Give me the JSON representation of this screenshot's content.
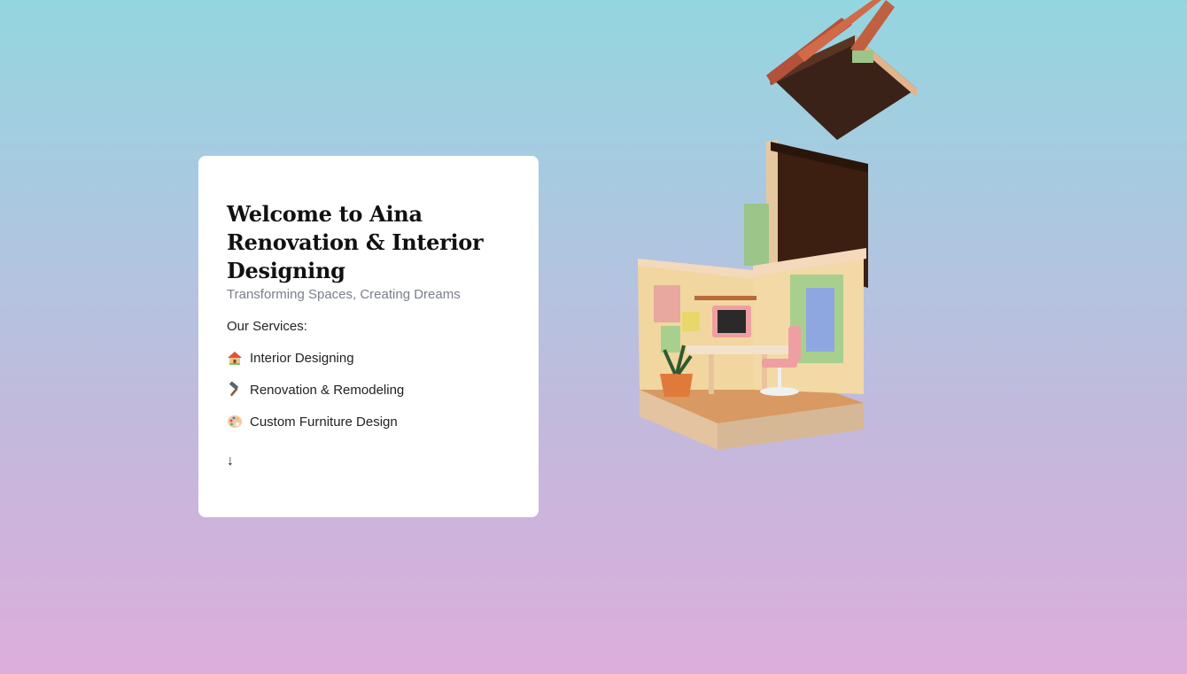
{
  "hero": {
    "title_line1": "Welcome to Aina",
    "title_line2": "Renovation & Interior",
    "title_line3": "Designing",
    "subtitle": "Transforming Spaces, Creating Dreams"
  },
  "services": {
    "heading": "Our Services:",
    "items": [
      {
        "icon": "house-icon",
        "label": "Interior Designing"
      },
      {
        "icon": "hammer-icon",
        "label": "Renovation & Remodeling"
      },
      {
        "icon": "palette-icon",
        "label": "Custom Furniture Design"
      }
    ]
  },
  "scroll_arrow": "↓",
  "colors": {
    "gradient_top": "#94d6e0",
    "gradient_bottom": "#dcaedb",
    "card_bg": "#ffffff"
  }
}
